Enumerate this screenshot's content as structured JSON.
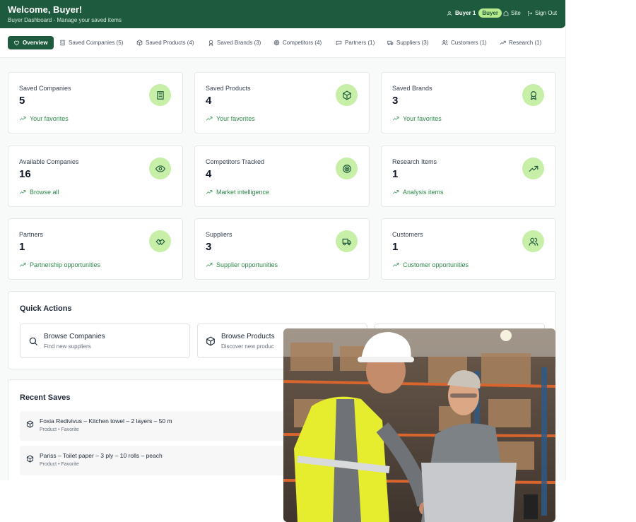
{
  "header": {
    "title": "Welcome, Buyer!",
    "subtitle": "Buyer Dashboard - Manage your saved items",
    "user_name": "Buyer 1",
    "user_role": "Buyer",
    "site_label": "Site",
    "signout_label": "Sign Out"
  },
  "tabs": [
    {
      "label": "Overview",
      "icon": "heart-icon"
    },
    {
      "label": "Saved Companies (5)",
      "icon": "building-icon"
    },
    {
      "label": "Saved Products (4)",
      "icon": "box-icon"
    },
    {
      "label": "Saved Brands (3)",
      "icon": "award-icon"
    },
    {
      "label": "Competitors (4)",
      "icon": "target-icon"
    },
    {
      "label": "Partners (1)",
      "icon": "handshake-icon"
    },
    {
      "label": "Suppliers (3)",
      "icon": "truck-icon"
    },
    {
      "label": "Customers (1)",
      "icon": "users-icon"
    },
    {
      "label": "Research (1)",
      "icon": "trending-up-icon"
    }
  ],
  "stats": [
    {
      "label": "Saved Companies",
      "value": "5",
      "note": "Your favorites",
      "icon": "building-icon"
    },
    {
      "label": "Saved Products",
      "value": "4",
      "note": "Your favorites",
      "icon": "box-icon"
    },
    {
      "label": "Saved Brands",
      "value": "3",
      "note": "Your favorites",
      "icon": "award-icon"
    },
    {
      "label": "Available Companies",
      "value": "16",
      "note": "Browse all",
      "icon": "eye-icon"
    },
    {
      "label": "Competitors Tracked",
      "value": "4",
      "note": "Market intelligence",
      "icon": "target-icon"
    },
    {
      "label": "Research Items",
      "value": "1",
      "note": "Analysis items",
      "icon": "trending-up-icon"
    },
    {
      "label": "Partners",
      "value": "1",
      "note": "Partnership opportunities",
      "icon": "handshake-icon"
    },
    {
      "label": "Suppliers",
      "value": "3",
      "note": "Supplier opportunities",
      "icon": "truck-icon"
    },
    {
      "label": "Customers",
      "value": "1",
      "note": "Customer opportunities",
      "icon": "users-icon"
    }
  ],
  "quick_actions": {
    "title": "Quick Actions",
    "items": [
      {
        "title": "Browse Companies",
        "subtitle": "Find new suppliers",
        "icon": "search-icon"
      },
      {
        "title": "Browse Products",
        "subtitle": "Discover new produc",
        "icon": "box-icon"
      }
    ]
  },
  "recent_saves": {
    "title": "Recent Saves",
    "items": [
      {
        "title": "Foxia Redivivus – Kitchen towel – 2 layers – 50 m",
        "meta": "Product • Favorite",
        "icon": "box-icon"
      },
      {
        "title": "Pariss – Toilet paper – 3 ply – 10 rolls – peach",
        "meta": "Product • Favorite",
        "icon": "box-icon"
      }
    ]
  },
  "colors": {
    "brand": "#1e5a3d",
    "accent": "#c8efa8",
    "positive": "#2f8a4c"
  }
}
